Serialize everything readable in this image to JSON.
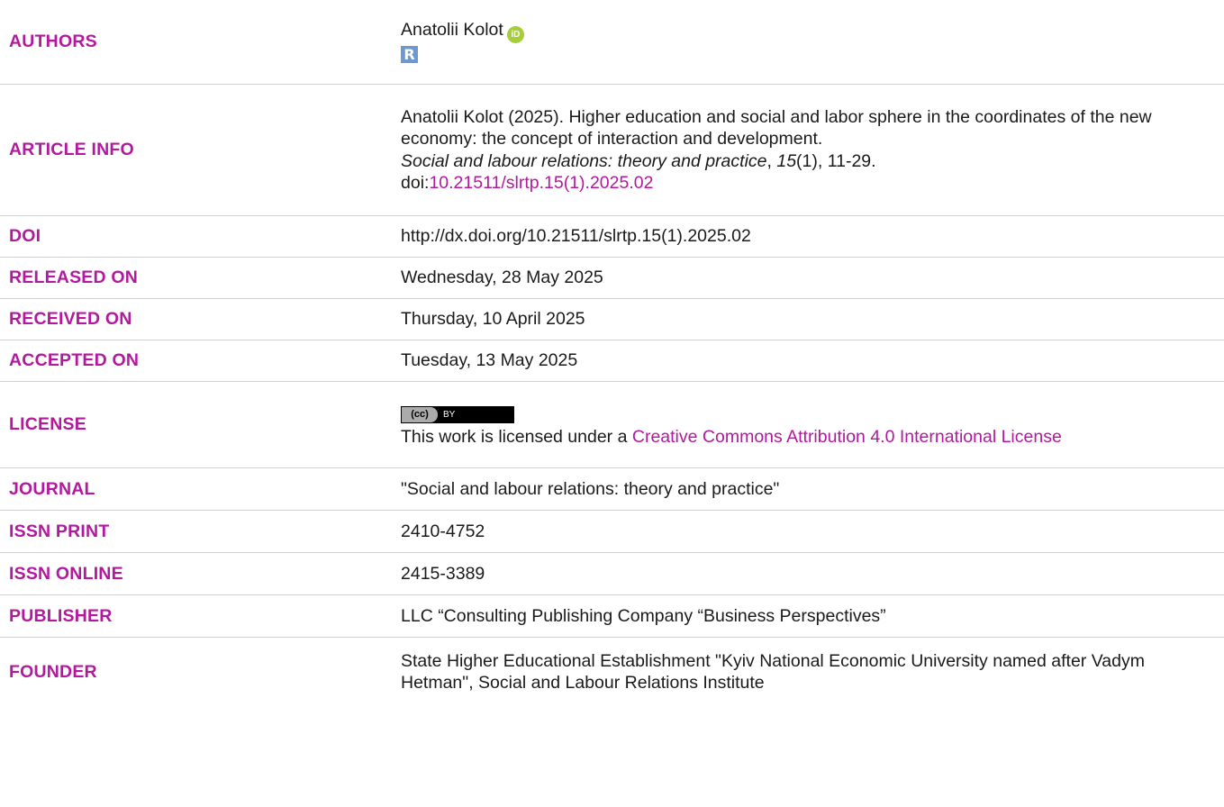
{
  "rows": {
    "authors": {
      "label": "AUTHORS",
      "name": "Anatolii Kolot",
      "orcid_icon_text": "iD",
      "researchgate_icon_text": "R"
    },
    "article_info": {
      "label": "ARTICLE INFO",
      "citation_text": "Anatolii Kolot (2025). Higher education and social and labor sphere in the coordinates of the new economy: the concept of interaction and development.",
      "journal_italic": "Social and labour relations: theory and practice",
      "comma1": ", ",
      "volume_italic": "15",
      "issue_pages": "(1), 11-29.",
      "doi_prefix": "doi:",
      "doi_link": "10.21511/slrtp.15(1).2025.02"
    },
    "doi": {
      "label": "DOI",
      "value": "http://dx.doi.org/10.21511/slrtp.15(1).2025.02"
    },
    "released_on": {
      "label": "RELEASED ON",
      "value": "Wednesday, 28 May 2025"
    },
    "received_on": {
      "label": "RECEIVED ON",
      "value": "Thursday, 10 April 2025"
    },
    "accepted_on": {
      "label": "ACCEPTED ON",
      "value": "Tuesday, 13 May 2025"
    },
    "license": {
      "label": "LICENSE",
      "badge_cc": "(cc)",
      "badge_by": "BY",
      "text_prefix": "This work is licensed under a ",
      "link_text": "Creative Commons Attribution 4.0 International License"
    },
    "journal": {
      "label": "JOURNAL",
      "value": "\"Social and labour relations: theory and practice\""
    },
    "issn_print": {
      "label": "ISSN PRINT",
      "value": "2410-4752"
    },
    "issn_online": {
      "label": "ISSN ONLINE",
      "value": "2415-3389"
    },
    "publisher": {
      "label": "PUBLISHER",
      "value": "LLC “Consulting Publishing Company “Business Perspectives”"
    },
    "founder": {
      "label": "FOUNDER",
      "value": "State Higher Educational Establishment \"Kyiv National Economic University named after Vadym Hetman\", Social and Labour Relations Institute"
    }
  },
  "colors": {
    "label_accent": "#b3189e",
    "text": "#1a1a1a",
    "divider": "#d0d0d0",
    "orcid_green": "#a6ce39",
    "researchgate_blue": "#6c9ad0"
  }
}
